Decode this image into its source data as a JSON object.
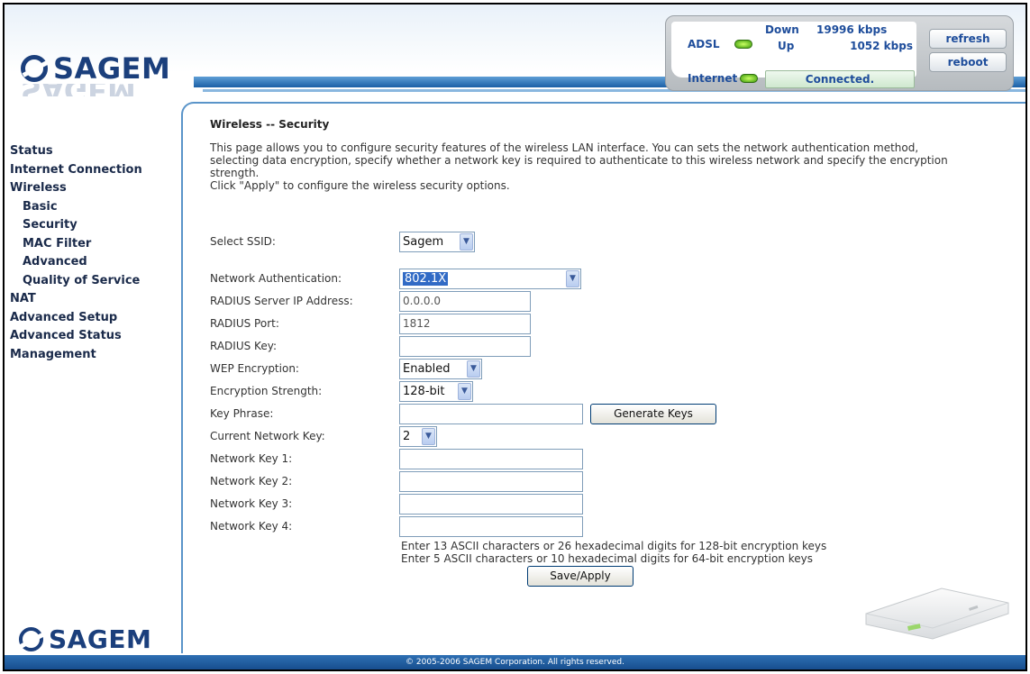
{
  "brand": {
    "logo_text": "SAGEM"
  },
  "status": {
    "adsl_label": "ADSL",
    "internet_label": "Internet",
    "down_label": "Down",
    "down_value": "19996 kbps",
    "up_label": "Up",
    "up_value": "1052 kbps",
    "connection_text": "Connected.",
    "refresh_label": "refresh",
    "reboot_label": "reboot"
  },
  "nav": {
    "items": [
      {
        "label": "Status",
        "sub": false
      },
      {
        "label": "Internet Connection",
        "sub": false
      },
      {
        "label": "Wireless",
        "sub": false
      },
      {
        "label": "Basic",
        "sub": true
      },
      {
        "label": "Security",
        "sub": true
      },
      {
        "label": "MAC Filter",
        "sub": true
      },
      {
        "label": "Advanced",
        "sub": true
      },
      {
        "label": "Quality of Service",
        "sub": true
      },
      {
        "label": "NAT",
        "sub": false
      },
      {
        "label": "Advanced Setup",
        "sub": false
      },
      {
        "label": "Advanced Status",
        "sub": false
      },
      {
        "label": "Management",
        "sub": false
      }
    ]
  },
  "page": {
    "title": "Wireless -- Security",
    "description": "This page allows you to configure security features of the wireless LAN interface. You can sets the network authentication method, selecting data encryption, specify whether a network key is required to authenticate to this wireless network and specify the encryption strength.",
    "click_text": "Click \"Apply\" to configure the wireless security options."
  },
  "form": {
    "ssid": {
      "label": "Select SSID:",
      "value": "Sagem"
    },
    "auth": {
      "label": "Network Authentication:",
      "value": "802.1X"
    },
    "radius_ip": {
      "label": "RADIUS Server IP Address:",
      "value": "0.0.0.0"
    },
    "radius_port": {
      "label": "RADIUS Port:",
      "value": "1812"
    },
    "radius_key": {
      "label": "RADIUS Key:",
      "value": ""
    },
    "wep": {
      "label": "WEP Encryption:",
      "value": "Enabled"
    },
    "strength": {
      "label": "Encryption Strength:",
      "value": "128-bit"
    },
    "key_phrase": {
      "label": "Key Phrase:",
      "value": ""
    },
    "generate_label": "Generate Keys",
    "current_key": {
      "label": "Current Network Key:",
      "value": "2"
    },
    "key1": {
      "label": "Network Key 1:",
      "value": ""
    },
    "key2": {
      "label": "Network Key 2:",
      "value": ""
    },
    "key3": {
      "label": "Network Key 3:",
      "value": ""
    },
    "key4": {
      "label": "Network Key 4:",
      "value": ""
    },
    "hint_128": "Enter 13 ASCII characters or 26 hexadecimal digits for 128-bit encryption keys",
    "hint_64": "Enter 5 ASCII characters or 10 hexadecimal digits for 64-bit encryption keys",
    "save_label": "Save/Apply"
  },
  "footer": {
    "text": "© 2005-2006 SAGEM Corporation. All rights reserved."
  },
  "icons": {
    "select_arrow": "chevron-down-icon",
    "led": "status-led-icon",
    "logo": "sagem-logo-icon",
    "router": "router-image"
  },
  "colors": {
    "brand_blue": "#1b3f7c",
    "bar_blue": "#1b5fa6",
    "led_green": "#3b9a0a",
    "selection": "#316ac5"
  }
}
